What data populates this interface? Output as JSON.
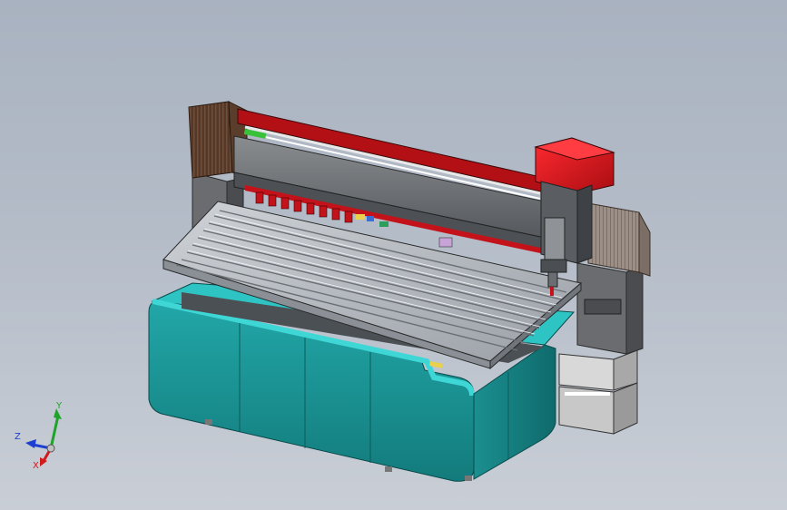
{
  "triad": {
    "x_label": "X",
    "y_label": "Y",
    "z_label": "Z"
  },
  "colors": {
    "background_top": "#a9b2c0",
    "background_bottom": "#c9ced6",
    "base_teal": "#1a9b9b",
    "base_teal_light": "#2fc4c4",
    "gantry_gray": "#6e6e6e",
    "gantry_red": "#c4121a",
    "spindle_red": "#e0141c",
    "table_silver": "#b9bec4",
    "bellows_brown": "#6b4a35"
  },
  "icons": {
    "triad": "coordinate-triad-icon"
  }
}
